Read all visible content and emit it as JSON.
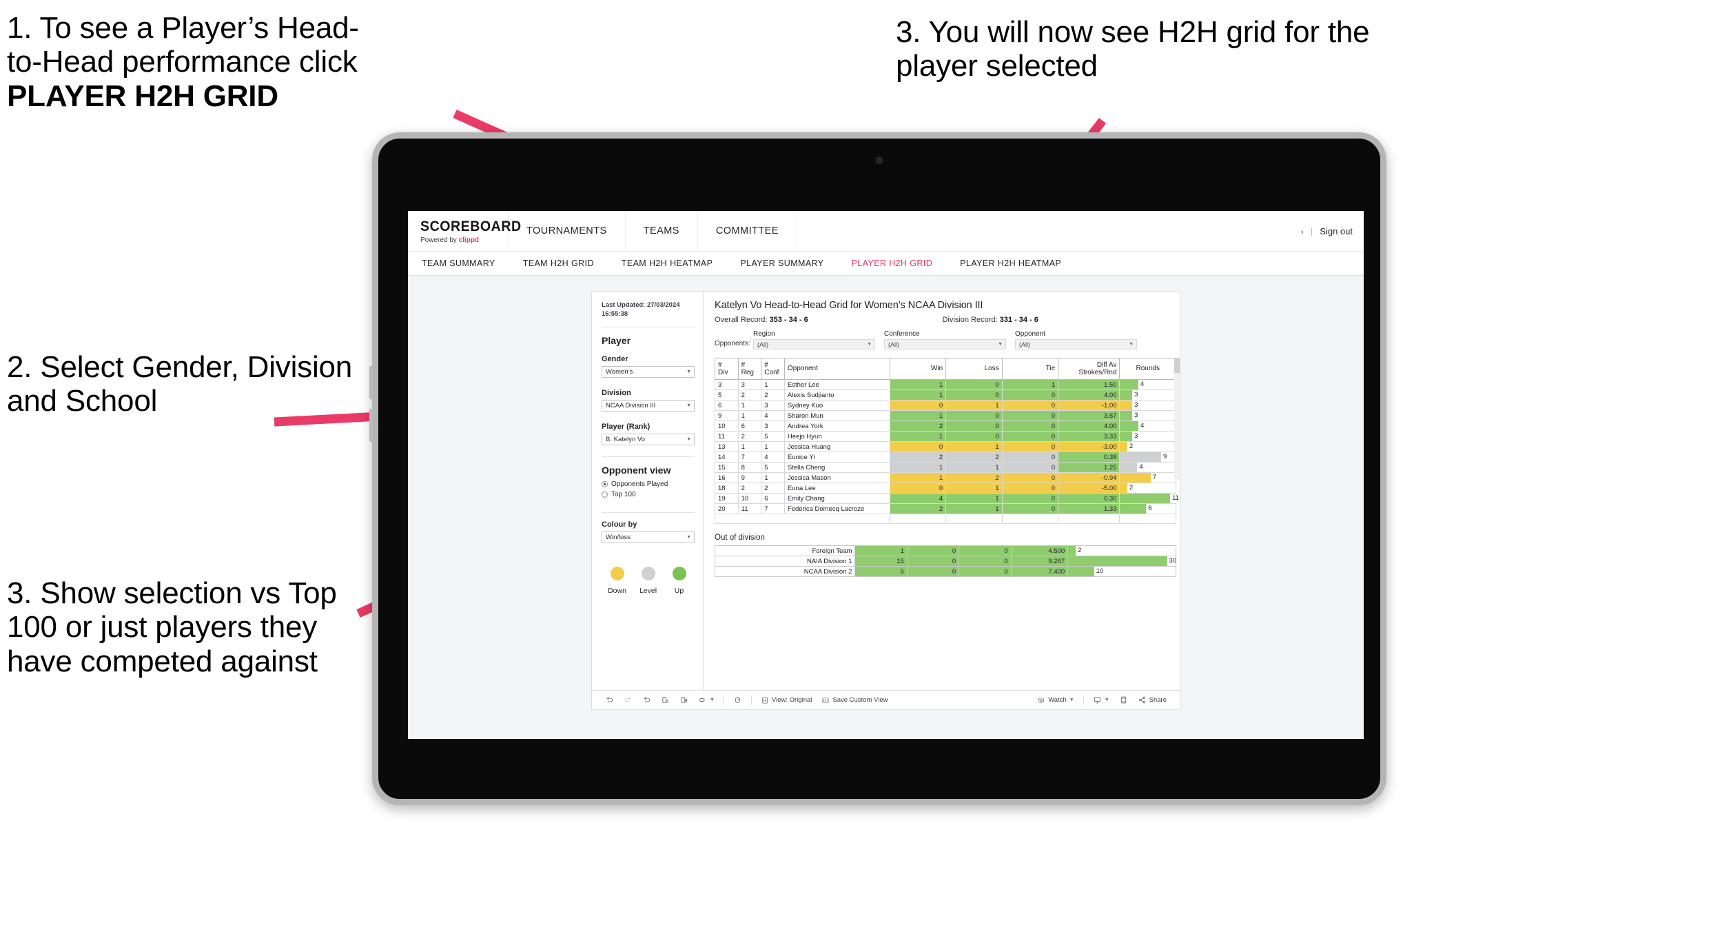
{
  "annotations": {
    "note1_line1": "1. To see a Player’s Head-",
    "note1_line2": "to-Head performance click",
    "note1_bold": "PLAYER H2H GRID",
    "note2": "2. Select Gender, Division and School",
    "note3": "3. Show selection vs Top 100 or just players they have competed against",
    "note4": "3. You will now see H2H grid for the player selected",
    "arrow_color": "#ea3a66"
  },
  "app": {
    "brand_name": "SCOREBOARD",
    "brand_tagline_prefix": "Powered by ",
    "brand_tagline_accent": "clippd",
    "accent_color": "#e8385c",
    "top_nav": [
      "TOURNAMENTS",
      "TEAMS",
      "COMMITTEE"
    ],
    "account_chevron": "›",
    "account_separator": "|",
    "sign_out": "Sign out",
    "sub_nav": [
      {
        "label": "TEAM SUMMARY",
        "active": false
      },
      {
        "label": "TEAM H2H GRID",
        "active": false
      },
      {
        "label": "TEAM H2H HEATMAP",
        "active": false
      },
      {
        "label": "PLAYER SUMMARY",
        "active": false
      },
      {
        "label": "PLAYER H2H GRID",
        "active": true
      },
      {
        "label": "PLAYER H2H HEATMAP",
        "active": false
      }
    ]
  },
  "sidepanel": {
    "last_updated": "Last Updated: 27/03/2024 16:55:38",
    "section_title": "Player",
    "gender_label": "Gender",
    "gender_value": "Women’s",
    "division_label": "Division",
    "division_value": "NCAA Division III",
    "player_label": "Player (Rank)",
    "player_value": "B. Katelyn Vo",
    "opponent_view_title": "Opponent view",
    "opponent_options": [
      {
        "label": "Opponents Played",
        "selected": true
      },
      {
        "label": "Top 100",
        "selected": false
      }
    ],
    "colour_by_label": "Colour by",
    "colour_by_value": "Win/loss",
    "legend": [
      {
        "label": "Down",
        "color": "#f3cd4a"
      },
      {
        "label": "Level",
        "color": "#cfd0d2"
      },
      {
        "label": "Up",
        "color": "#7cc24f"
      }
    ]
  },
  "main": {
    "title": "Katelyn Vo Head-to-Head Grid for Women’s NCAA Division III",
    "overall_record_label": "Overall Record: ",
    "overall_record_value": "353 -  34 - 6",
    "division_record_label": "Division Record: ",
    "division_record_value": "331 -  34 - 6",
    "opponents_label": "Opponents:",
    "filters": [
      {
        "label": "Region",
        "value": "(All)"
      },
      {
        "label": "Conference",
        "value": "(All)"
      },
      {
        "label": "Opponent",
        "value": "(All)"
      }
    ],
    "columns": {
      "div": "#\nDiv",
      "div_l1": "#",
      "div_l2": "Div",
      "reg_l1": "#",
      "reg_l2": "Reg",
      "conf_l1": "#",
      "conf_l2": "Conf",
      "opponent": "Opponent",
      "win": "Win",
      "loss": "Loss",
      "tie": "Tie",
      "diff_l1": "Diff Av",
      "diff_l2": "Strokes/Rnd",
      "rounds": "Rounds"
    },
    "rows": [
      {
        "div": "3",
        "reg": "3",
        "conf": "1",
        "opponent": "Esther Lee",
        "win": "1",
        "loss": "0",
        "tie": "1",
        "diff": "1.50",
        "rounds": "4",
        "bar_pct": 33,
        "tone": "g"
      },
      {
        "div": "5",
        "reg": "2",
        "conf": "2",
        "opponent": "Alexis Sudjianto",
        "win": "1",
        "loss": "0",
        "tie": "0",
        "diff": "4.00",
        "rounds": "3",
        "bar_pct": 22,
        "tone": "g"
      },
      {
        "div": "6",
        "reg": "1",
        "conf": "3",
        "opponent": "Sydney Kuo",
        "win": "0",
        "loss": "1",
        "tie": "0",
        "diff": "-1.00",
        "rounds": "3",
        "bar_pct": 22,
        "tone": "y"
      },
      {
        "div": "9",
        "reg": "1",
        "conf": "4",
        "opponent": "Sharon Mun",
        "win": "1",
        "loss": "0",
        "tie": "0",
        "diff": "3.67",
        "rounds": "3",
        "bar_pct": 22,
        "tone": "g"
      },
      {
        "div": "10",
        "reg": "6",
        "conf": "3",
        "opponent": "Andrea York",
        "win": "2",
        "loss": "0",
        "tie": "0",
        "diff": "4.00",
        "rounds": "4",
        "bar_pct": 33,
        "tone": "g"
      },
      {
        "div": "11",
        "reg": "2",
        "conf": "5",
        "opponent": "Heejo Hyun",
        "win": "1",
        "loss": "0",
        "tie": "0",
        "diff": "3.33",
        "rounds": "3",
        "bar_pct": 22,
        "tone": "g"
      },
      {
        "div": "13",
        "reg": "1",
        "conf": "1",
        "opponent": "Jessica Huang",
        "win": "0",
        "loss": "1",
        "tie": "0",
        "diff": "-3.00",
        "rounds": "2",
        "bar_pct": 13,
        "tone": "y"
      },
      {
        "div": "14",
        "reg": "7",
        "conf": "4",
        "opponent": "Eunice Yi",
        "win": "2",
        "loss": "2",
        "tie": "0",
        "diff": "0.38",
        "rounds": "9",
        "bar_pct": 74,
        "tone": "n",
        "diff_tone": "g"
      },
      {
        "div": "15",
        "reg": "8",
        "conf": "5",
        "opponent": "Stella Cheng",
        "win": "1",
        "loss": "1",
        "tie": "0",
        "diff": "1.25",
        "rounds": "4",
        "bar_pct": 31,
        "tone": "n",
        "diff_tone": "g"
      },
      {
        "div": "16",
        "reg": "9",
        "conf": "1",
        "opponent": "Jessica Mason",
        "win": "1",
        "loss": "2",
        "tie": "0",
        "diff": "-0.94",
        "rounds": "7",
        "bar_pct": 55,
        "tone": "y"
      },
      {
        "div": "18",
        "reg": "2",
        "conf": "2",
        "opponent": "Euna Lee",
        "win": "0",
        "loss": "1",
        "tie": "0",
        "diff": "-5.00",
        "rounds": "2",
        "bar_pct": 13,
        "tone": "y"
      },
      {
        "div": "19",
        "reg": "10",
        "conf": "6",
        "opponent": "Emily Chang",
        "win": "4",
        "loss": "1",
        "tie": "0",
        "diff": "0.30",
        "rounds": "11",
        "bar_pct": 90,
        "tone": "g"
      },
      {
        "div": "20",
        "reg": "11",
        "conf": "7",
        "opponent": "Federica Domecq Lacroze",
        "win": "2",
        "loss": "1",
        "tie": "0",
        "diff": "1.33",
        "rounds": "6",
        "bar_pct": 47,
        "tone": "g"
      }
    ],
    "out_of_division_title": "Out of division",
    "out_of_division_rows": [
      {
        "name": "Foreign Team",
        "win": "1",
        "loss": "0",
        "tie": "0",
        "diff": "4.500",
        "rounds": "2",
        "bar_pct": 7,
        "tone": "g"
      },
      {
        "name": "NAIA Division 1",
        "win": "15",
        "loss": "0",
        "tie": "0",
        "diff": "9.267",
        "rounds": "30",
        "bar_pct": 92,
        "tone": "g"
      },
      {
        "name": "NCAA Division 2",
        "win": "5",
        "loss": "0",
        "tie": "0",
        "diff": "7.400",
        "rounds": "10",
        "bar_pct": 24,
        "tone": "g"
      }
    ]
  },
  "toolbar": {
    "undo": "undo-icon",
    "redo": "redo-icon",
    "revert": "revert-icon",
    "refresh": "refresh-icon",
    "pause": "pause-icon",
    "zoom": "zoom-icon",
    "highlight": "highlight-icon",
    "view_label": "View: Original",
    "save_label": "Save Custom View",
    "watch_label": "Watch",
    "download_icon": "download-icon",
    "fullscreen_icon": "fullscreen-icon",
    "share_label": "Share"
  }
}
